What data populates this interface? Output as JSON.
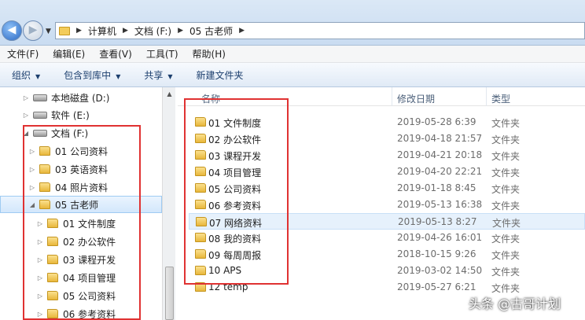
{
  "address": {
    "crumbs": [
      "计算机",
      "文档 (F:)",
      "05 古老师"
    ]
  },
  "menu": [
    "文件(F)",
    "编辑(E)",
    "查看(V)",
    "工具(T)",
    "帮助(H)"
  ],
  "toolbar": {
    "organize": "组织",
    "include_library": "包含到库中",
    "share": "共享",
    "new_folder": "新建文件夹"
  },
  "tree": [
    {
      "label": "本地磁盘 (D:)",
      "type": "drive",
      "selected": false
    },
    {
      "label": "软件 (E:)",
      "type": "drive",
      "selected": false
    },
    {
      "label": "文档 (F:)",
      "type": "drive",
      "selected": false
    },
    {
      "label": "01 公司资料",
      "type": "folder",
      "selected": false
    },
    {
      "label": "03 英语资料",
      "type": "folder",
      "selected": false
    },
    {
      "label": "04 照片资料",
      "type": "folder",
      "selected": false
    },
    {
      "label": "05 古老师",
      "type": "folder",
      "selected": true
    },
    {
      "label": "01 文件制度",
      "type": "folder",
      "selected": false
    },
    {
      "label": "02 办公软件",
      "type": "folder",
      "selected": false
    },
    {
      "label": "03 课程开发",
      "type": "folder",
      "selected": false
    },
    {
      "label": "04 项目管理",
      "type": "folder",
      "selected": false
    },
    {
      "label": "05 公司资料",
      "type": "folder",
      "selected": false
    },
    {
      "label": "06 参考资料",
      "type": "folder",
      "selected": false
    }
  ],
  "columns": {
    "name": "名称",
    "date": "修改日期",
    "type": "类型"
  },
  "files": [
    {
      "name": "01 文件制度",
      "date": "2019-05-28 6:39",
      "type": "文件夹",
      "highlighted": false
    },
    {
      "name": "02 办公软件",
      "date": "2019-04-18 21:57",
      "type": "文件夹",
      "highlighted": false
    },
    {
      "name": "03 课程开发",
      "date": "2019-04-21 20:18",
      "type": "文件夹",
      "highlighted": false
    },
    {
      "name": "04 项目管理",
      "date": "2019-04-20 22:21",
      "type": "文件夹",
      "highlighted": false
    },
    {
      "name": "05 公司资料",
      "date": "2019-01-18 8:45",
      "type": "文件夹",
      "highlighted": false
    },
    {
      "name": "06 参考资料",
      "date": "2019-05-13 16:38",
      "type": "文件夹",
      "highlighted": false
    },
    {
      "name": "07 网络资料",
      "date": "2019-05-13 8:27",
      "type": "文件夹",
      "highlighted": true
    },
    {
      "name": "08 我的资料",
      "date": "2019-04-26 16:01",
      "type": "文件夹",
      "highlighted": false
    },
    {
      "name": "09 每周周报",
      "date": "2018-10-15 9:26",
      "type": "文件夹",
      "highlighted": false
    },
    {
      "name": "10 APS",
      "date": "2019-03-02 14:50",
      "type": "文件夹",
      "highlighted": false
    },
    {
      "name": "12 temp",
      "date": "2019-05-27 6:21",
      "type": "文件夹",
      "highlighted": false
    }
  ],
  "watermark": "头条 @古哥计划",
  "colors": {
    "annotation_red": "#e03232",
    "selection_blue": "#d3e7fc"
  }
}
